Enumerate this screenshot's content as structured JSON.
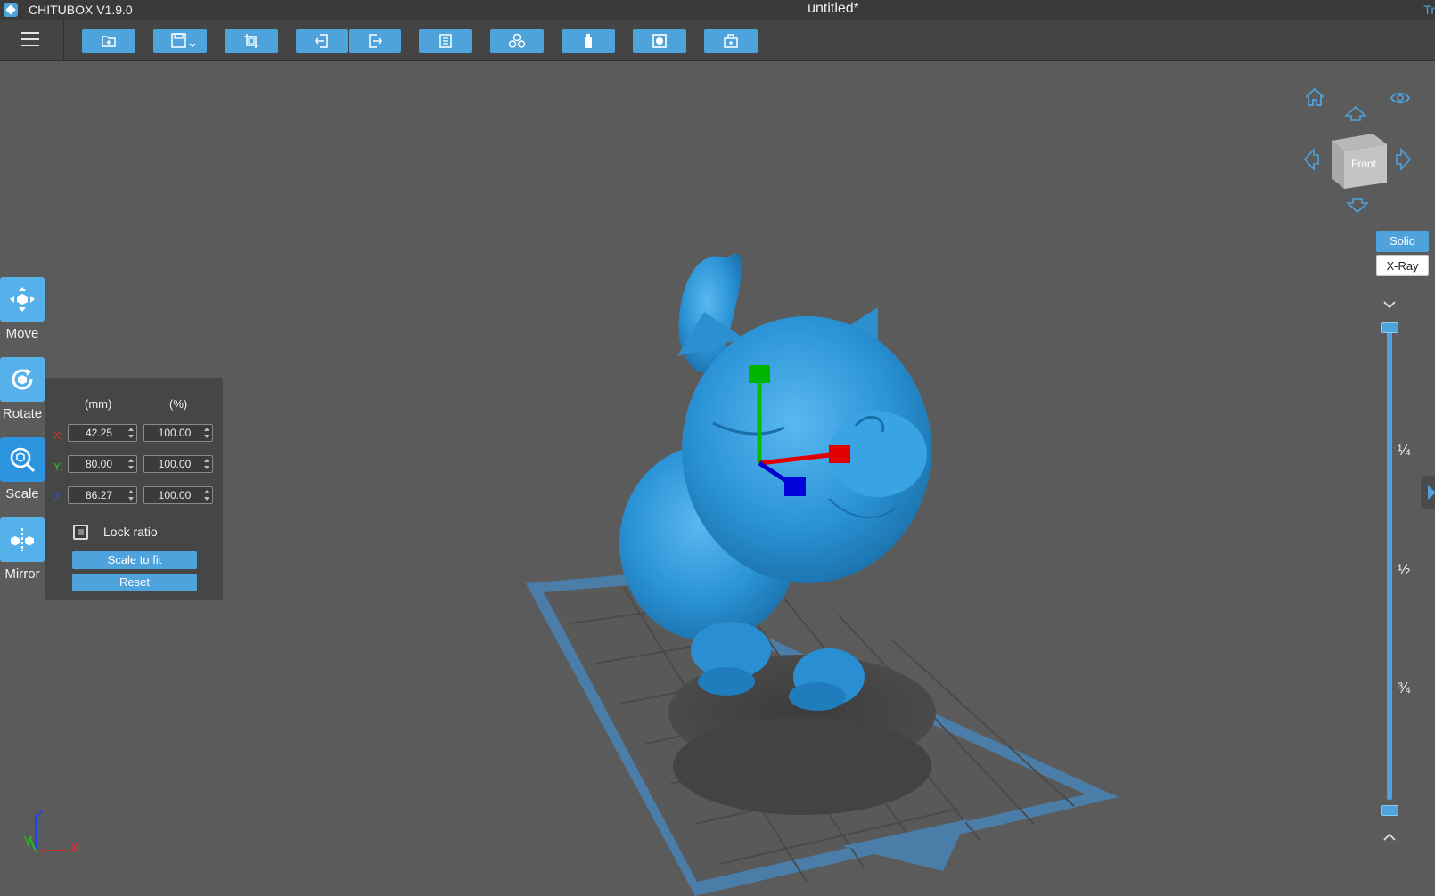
{
  "titlebar": {
    "app_name": "CHITUBOX V1.9.0",
    "document_title": "untitled*",
    "right_fragment": "Tr"
  },
  "toolbar": {
    "buttons": [
      {
        "name": "open-file-button",
        "icon": "folder-open-icon"
      },
      {
        "name": "save-button",
        "icon": "save-icon"
      },
      {
        "name": "crop-button",
        "icon": "crop-icon"
      },
      {
        "name": "import-button",
        "icon": "import-icon"
      },
      {
        "name": "export-button",
        "icon": "export-icon"
      },
      {
        "name": "layout-button",
        "icon": "layers-icon"
      },
      {
        "name": "arrange-button",
        "icon": "cubes-icon"
      },
      {
        "name": "support-button",
        "icon": "bottle-icon"
      },
      {
        "name": "hollow-button",
        "icon": "hollow-icon"
      },
      {
        "name": "slice-button",
        "icon": "slice-icon"
      }
    ],
    "accent_color": "#4ea3dc"
  },
  "tools": {
    "move": "Move",
    "rotate": "Rotate",
    "scale": "Scale",
    "mirror": "Mirror"
  },
  "scale_panel": {
    "col_mm": "(mm)",
    "col_pct": "(%)",
    "x": {
      "label": "X:",
      "mm": "42.25",
      "pct": "100.00"
    },
    "y": {
      "label": "Y:",
      "mm": "80.00",
      "pct": "100.00"
    },
    "z": {
      "label": "Z:",
      "mm": "86.27",
      "pct": "100.00"
    },
    "lock_ratio_label": "Lock ratio",
    "lock_ratio_checked": false,
    "scale_to_fit_label": "Scale to fit",
    "reset_label": "Reset"
  },
  "view": {
    "cube_face": "Front",
    "solid_label": "Solid",
    "xray_label": "X-Ray",
    "active_mode": "Solid",
    "slider_fractions": [
      "¼",
      "½",
      "¾"
    ]
  },
  "axes_indicator": {
    "z": "Z",
    "y": "Y",
    "x": "X"
  }
}
